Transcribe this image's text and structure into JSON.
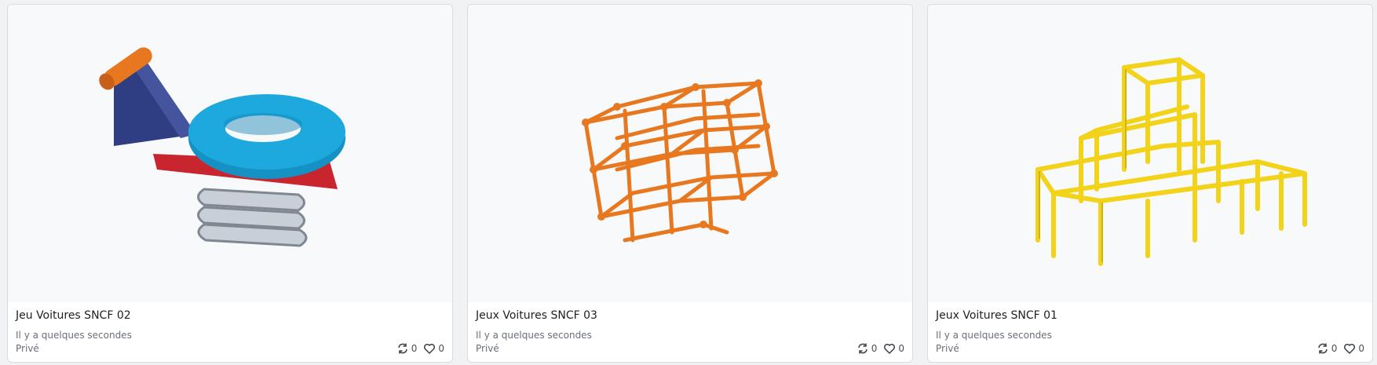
{
  "cards": [
    {
      "title": "Jeu Voitures SNCF 02",
      "time": "Il y a quelques secondes",
      "privacy": "Privé",
      "remixes": "0",
      "likes": "0",
      "thumbnail": "spring-rider-toy"
    },
    {
      "title": "Jeux Voitures SNCF 03",
      "time": "Il y a quelques secondes",
      "privacy": "Privé",
      "remixes": "0",
      "likes": "0",
      "thumbnail": "orange-cube-lattice"
    },
    {
      "title": "Jeux Voitures SNCF 01",
      "time": "Il y a quelques secondes",
      "privacy": "Privé",
      "remixes": "0",
      "likes": "0",
      "thumbnail": "yellow-climbing-frame"
    }
  ],
  "icons": {
    "remix": "remix-icon",
    "like": "heart-icon"
  },
  "colors": {
    "orange": "#e8781f",
    "yellow": "#f3d21a",
    "blue": "#1aa3d9",
    "navy": "#3d4f9f"
  }
}
